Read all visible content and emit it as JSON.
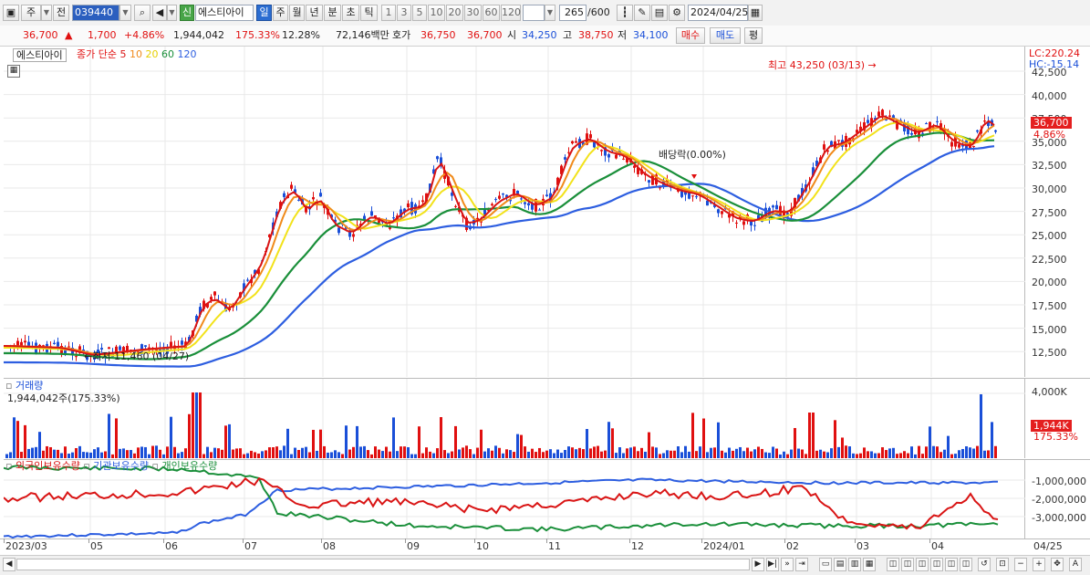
{
  "toolbar": {
    "mode": "주",
    "prev": "전",
    "code": "039440",
    "new_badge": "신",
    "stock_name": "에스티아이",
    "periods": [
      "일",
      "주",
      "월",
      "년",
      "분",
      "초",
      "틱"
    ],
    "active_period": "일",
    "intervals": [
      "1",
      "3",
      "5",
      "10",
      "20",
      "30",
      "60",
      "120"
    ],
    "count": "265",
    "count_total": "/600",
    "date": "2024/04/25"
  },
  "quote": {
    "price": "36,700",
    "up_arrow": "▲",
    "change": "1,700",
    "change_pct": "+4.86%",
    "volume": "1,944,042",
    "vol_ratio": "175.33%",
    "turnover": "12.28%",
    "amount": "72,146백만",
    "ask_label": "호가",
    "ask": "36,750",
    "bid": "36,700",
    "open_label": "시",
    "open": "34,250",
    "high_label": "고",
    "high": "38,750",
    "low_label": "저",
    "low": "34,100",
    "buy": "매수",
    "sell": "매도",
    "avg": "평"
  },
  "chart": {
    "stock_tab": "에스티아이",
    "ma_legend_label": "종가 단순",
    "ma_periods": [
      "5",
      "10",
      "20",
      "60",
      "120"
    ],
    "ma_colors": [
      "#d91414",
      "#f08a1a",
      "#f2e21a",
      "#1a8f3a",
      "#2d5ee0"
    ],
    "lc": "LC:220.24",
    "hc": "HC:-15.14",
    "high_note": "최고 43,250 (03/13)",
    "low_note": "최저 11,460 (04/27)",
    "div_note": "배당락(0.00%)",
    "price_tag": "36,700",
    "pct_tag": "4.86%",
    "y_ticks": [
      "42,500",
      "40,000",
      "37,500",
      "35,000",
      "32,500",
      "30,000",
      "27,500",
      "25,000",
      "22,500",
      "20,000",
      "17,500",
      "15,000",
      "12,500"
    ]
  },
  "volume_pane": {
    "title": "거래량",
    "value": "1,944,042주(175.33%)",
    "tick": "4,000K",
    "tag": "1,944K",
    "tag2": "175.33%"
  },
  "holdings_pane": {
    "legend": [
      "외국인보유수량",
      "기관보유수량",
      "개인보유수량"
    ],
    "legend_colors": [
      "#d91414",
      "#2d5ee0",
      "#1a8f3a"
    ],
    "ticks": [
      "-1,000,000",
      "-2,000,000",
      "-3,000,000"
    ]
  },
  "x_axis": {
    "labels": [
      "2023/03",
      "05",
      "06",
      "07",
      "08",
      "09",
      "10",
      "11",
      "12",
      "2024/01",
      "02",
      "03",
      "04"
    ],
    "last": "04/25"
  },
  "icons": [
    "chart-type-icon",
    "search-icon",
    "speaker-icon",
    "candle-icon",
    "draw-icon",
    "save-icon",
    "gear-icon",
    "calendar-icon"
  ]
}
